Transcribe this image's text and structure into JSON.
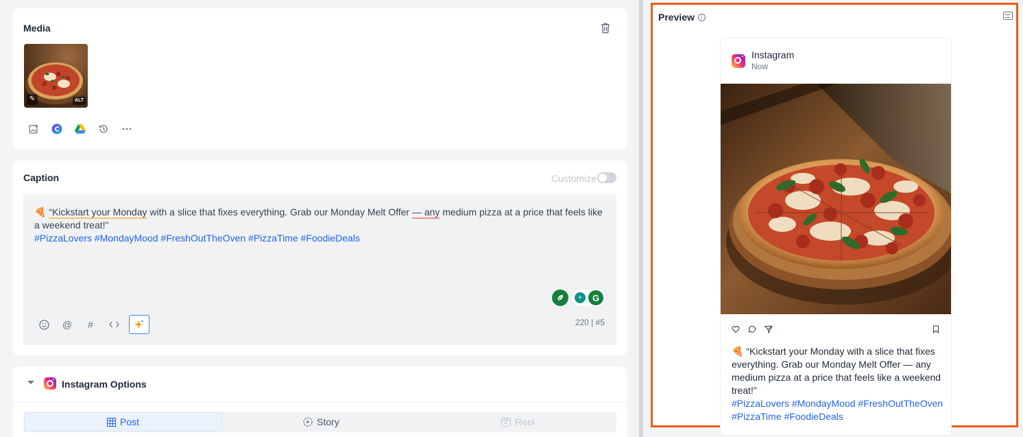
{
  "media": {
    "title": "Media",
    "thumb_alt_badge": "ALT",
    "tools": [
      "add-image-icon",
      "canva-icon",
      "google-drive-icon",
      "history-icon",
      "more-icon"
    ]
  },
  "caption": {
    "title": "Caption",
    "customize_label": "Customize",
    "text_emoji": "🍕",
    "text_part1": "“Kickstart your Monday",
    "text_part2": " with a slice that fixes everything. Grab our Monday Melt Offer ",
    "text_part3": "— any",
    "text_part4": " medium pizza at a price that feels like a weekend treat!”",
    "hashtags": "#PizzaLovers #MondayMood #FreshOutTheOven #PizzaTime #FoodieDeals",
    "char_count": "220",
    "hashtag_count": "#5",
    "tools": [
      "emoji-icon",
      "mention-icon",
      "hashtag-icon",
      "code-icon",
      "ai-sparkle-icon"
    ]
  },
  "instagram_options": {
    "title": "Instagram Options",
    "tabs": [
      {
        "label": "Post",
        "state": "active"
      },
      {
        "label": "Story",
        "state": "normal"
      },
      {
        "label": "Reel",
        "state": "disabled"
      }
    ]
  },
  "preview": {
    "title": "Preview",
    "post_account": "Instagram",
    "post_time": "Now",
    "caption_emoji": "🍕",
    "caption_text": "“Kickstart your Monday with a slice that fixes everything. Grab our Monday Melt Offer — any medium pizza at a price that feels like a weekend treat!”",
    "caption_hashtags": "#PizzaLovers #MondayMood #FreshOutTheOven #PizzaTime #FoodieDeals"
  },
  "colors": {
    "accent_blue": "#2563eb",
    "highlight_border": "#f05a14",
    "grammarly_green": "#15803d"
  }
}
